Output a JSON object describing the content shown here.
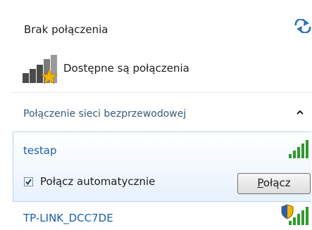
{
  "header": {
    "status_title": "Brak połączenia",
    "available_label": "Dostępne są połączenia"
  },
  "wireless": {
    "section_label": "Połączenie sieci bezprzewodowej",
    "networks": [
      {
        "ssid": "testap",
        "signal_bars": 5,
        "secured": false,
        "selected": true
      },
      {
        "ssid": "TP-LINK_DCC7DE",
        "signal_bars": 5,
        "secured": true,
        "selected": false
      }
    ],
    "auto_connect_label": "Połącz automatycznie",
    "auto_connect_checked": true,
    "connect_label_first": "P",
    "connect_label_rest": "ołącz"
  },
  "icons": {
    "refresh": "refresh-icon",
    "network_bars": "network-bars-icon",
    "chevron": "chevron-up-icon",
    "signal": "wifi-signal-icon",
    "shield": "security-shield-icon"
  },
  "colors": {
    "link_blue": "#1c5fa8",
    "section_text": "#3a5a78",
    "selection_border": "#b8d4f0",
    "signal_green": "#2e9b2e",
    "warning_star": "#f2b400"
  }
}
